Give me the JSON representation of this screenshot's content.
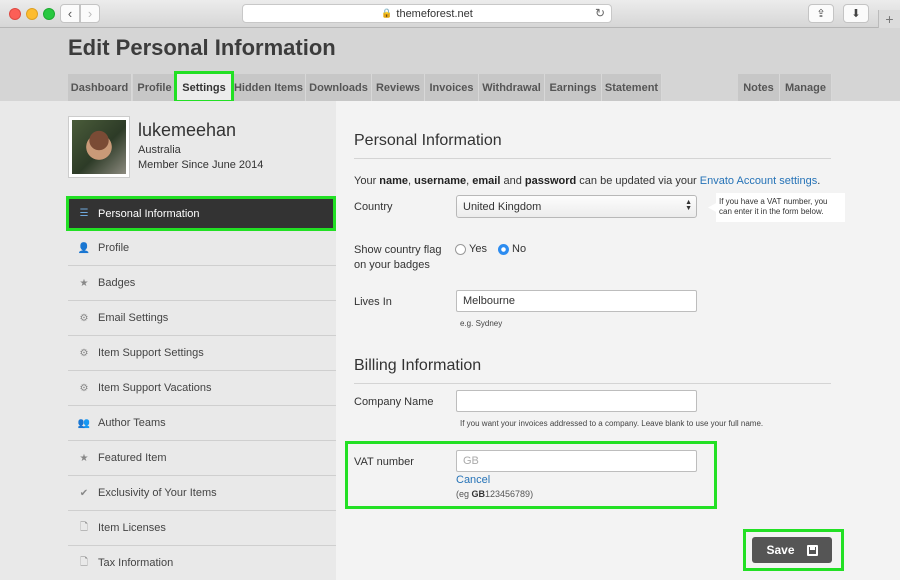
{
  "browser": {
    "url": "themeforest.net",
    "back_glyph": "‹",
    "forward_glyph": "›",
    "lock_glyph": "🔒",
    "reload_glyph": "↻",
    "share_glyph": "⇪",
    "download_glyph": "⬇",
    "newtab_glyph": "+"
  },
  "page": {
    "title": "Edit Personal Information"
  },
  "tabs": [
    {
      "label": "Dashboard"
    },
    {
      "label": "Profile"
    },
    {
      "label": "Settings",
      "active": true
    },
    {
      "label": "Hidden Items"
    },
    {
      "label": "Downloads"
    },
    {
      "label": "Reviews"
    },
    {
      "label": "Invoices"
    },
    {
      "label": "Withdrawal"
    },
    {
      "label": "Earnings"
    },
    {
      "label": "Statement"
    },
    {
      "label": "Notes"
    },
    {
      "label": "Manage"
    }
  ],
  "profile": {
    "username": "lukemeehan",
    "country": "Australia",
    "member_since": "Member Since June 2014"
  },
  "sidebar": {
    "items": [
      {
        "label": "Personal Information",
        "icon": "list-icon",
        "glyph": "☰",
        "active": true
      },
      {
        "label": "Profile",
        "icon": "user-icon",
        "glyph": "👤"
      },
      {
        "label": "Badges",
        "icon": "star-icon",
        "glyph": "★"
      },
      {
        "label": "Email Settings",
        "icon": "gear-icon",
        "glyph": "⚙"
      },
      {
        "label": "Item Support Settings",
        "icon": "gear-icon",
        "glyph": "⚙"
      },
      {
        "label": "Item Support Vacations",
        "icon": "gear-icon",
        "glyph": "⚙"
      },
      {
        "label": "Author Teams",
        "icon": "users-icon",
        "glyph": "👥"
      },
      {
        "label": "Featured Item",
        "icon": "star-icon",
        "glyph": "★"
      },
      {
        "label": "Exclusivity of Your Items",
        "icon": "check-icon",
        "glyph": "✔"
      },
      {
        "label": "Item Licenses",
        "icon": "document-icon",
        "glyph": "🗋"
      },
      {
        "label": "Tax Information",
        "icon": "document-icon",
        "glyph": "🗋"
      }
    ]
  },
  "personal": {
    "heading": "Personal Information",
    "intro_prefix": "Your ",
    "intro_name": "name",
    "intro_sep1": ", ",
    "intro_username": "username",
    "intro_sep2": ", ",
    "intro_email": "email",
    "intro_and": " and ",
    "intro_password": "password",
    "intro_suffix": " can be updated via your ",
    "intro_link": "Envato Account settings",
    "intro_end": ".",
    "country_label": "Country",
    "country_value": "United Kingdom",
    "vat_tip": "If you have a VAT number, you can enter it in the form below.",
    "flag_label_1": "Show country flag",
    "flag_label_2": "on your badges",
    "flag_yes": "Yes",
    "flag_no": "No",
    "flag_selected": "No",
    "lives_label": "Lives In",
    "lives_value": "Melbourne",
    "lives_hint": "e.g. Sydney"
  },
  "billing": {
    "heading": "Billing Information",
    "company_label": "Company Name",
    "company_value": "",
    "company_hint": "If you want your invoices addressed to a company. Leave blank to use your full name.",
    "vat_label": "VAT number",
    "vat_placeholder": "GB",
    "vat_cancel": "Cancel",
    "vat_eg_prefix": "(eg ",
    "vat_eg_bold": "GB",
    "vat_eg_suffix": "123456789)"
  },
  "actions": {
    "save_label": "Save"
  },
  "colors": {
    "highlight": "#22e024",
    "link": "#2673b7",
    "active_nav": "#333333",
    "radio_on": "#2d8cf0"
  }
}
